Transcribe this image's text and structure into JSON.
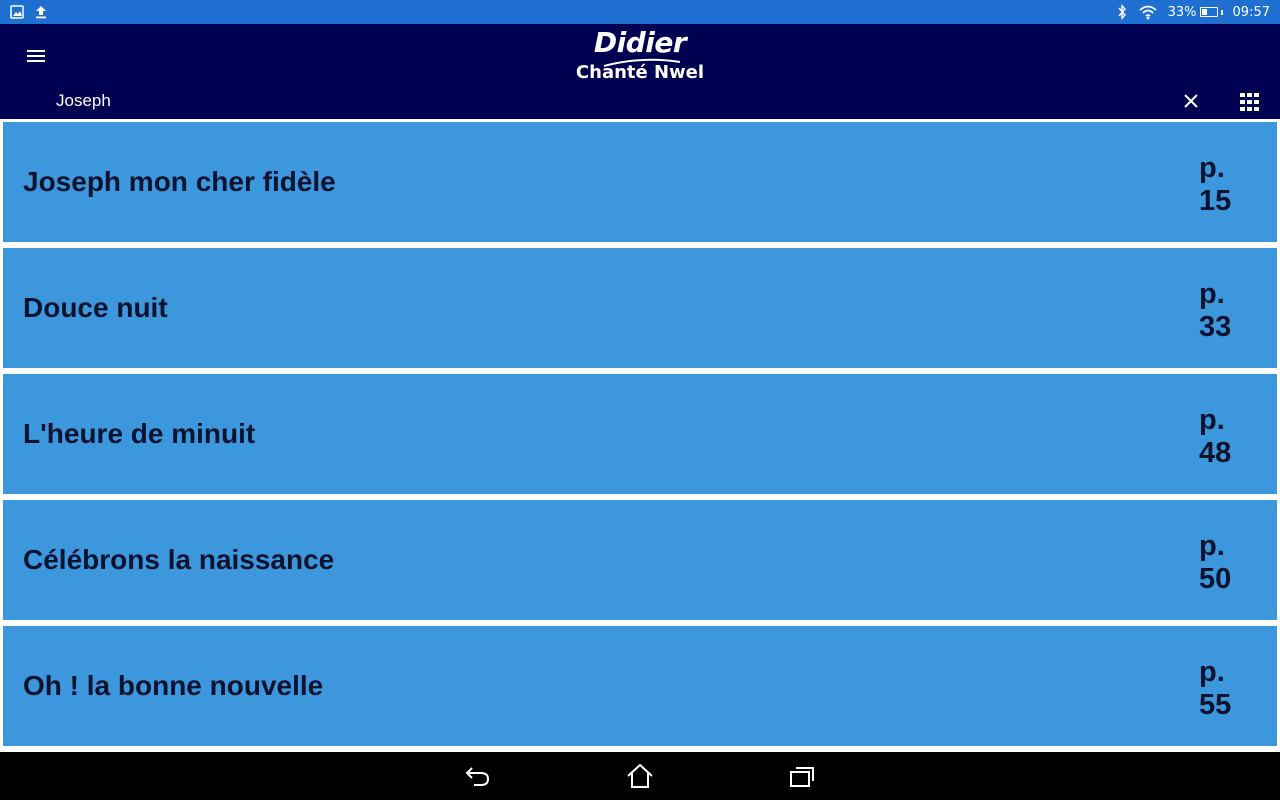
{
  "status_bar": {
    "battery_percent": "33%",
    "time": "09:57",
    "battery_level": 0.33,
    "icons": [
      "image-icon",
      "upload-icon",
      "bluetooth-icon",
      "wifi-icon",
      "battery-icon"
    ]
  },
  "app_bar": {
    "logo_brand": "Didier",
    "logo_sub": "Chanté Nwel",
    "search_value": "Joseph",
    "icons": [
      "menu-icon",
      "close-icon",
      "grid-icon"
    ]
  },
  "songs": [
    {
      "title": "Joseph mon cher fidèle",
      "page_prefix": "p.",
      "page_number": "15"
    },
    {
      "title": "Douce nuit",
      "page_prefix": "p.",
      "page_number": "33"
    },
    {
      "title": "L'heure de minuit",
      "page_prefix": "p.",
      "page_number": "48"
    },
    {
      "title": "Célébrons la naissance",
      "page_prefix": "p.",
      "page_number": "50"
    },
    {
      "title": "Oh ! la bonne nouvelle",
      "page_prefix": "p.",
      "page_number": "55"
    }
  ],
  "nav_bar": {
    "icons": [
      "back-icon",
      "home-icon",
      "recents-icon"
    ]
  },
  "colors": {
    "status_bar": "#1e6fd0",
    "app_bar": "#000052",
    "list_item": "#3d97dc",
    "list_text": "#0a1330",
    "nav_bar": "#000000"
  }
}
